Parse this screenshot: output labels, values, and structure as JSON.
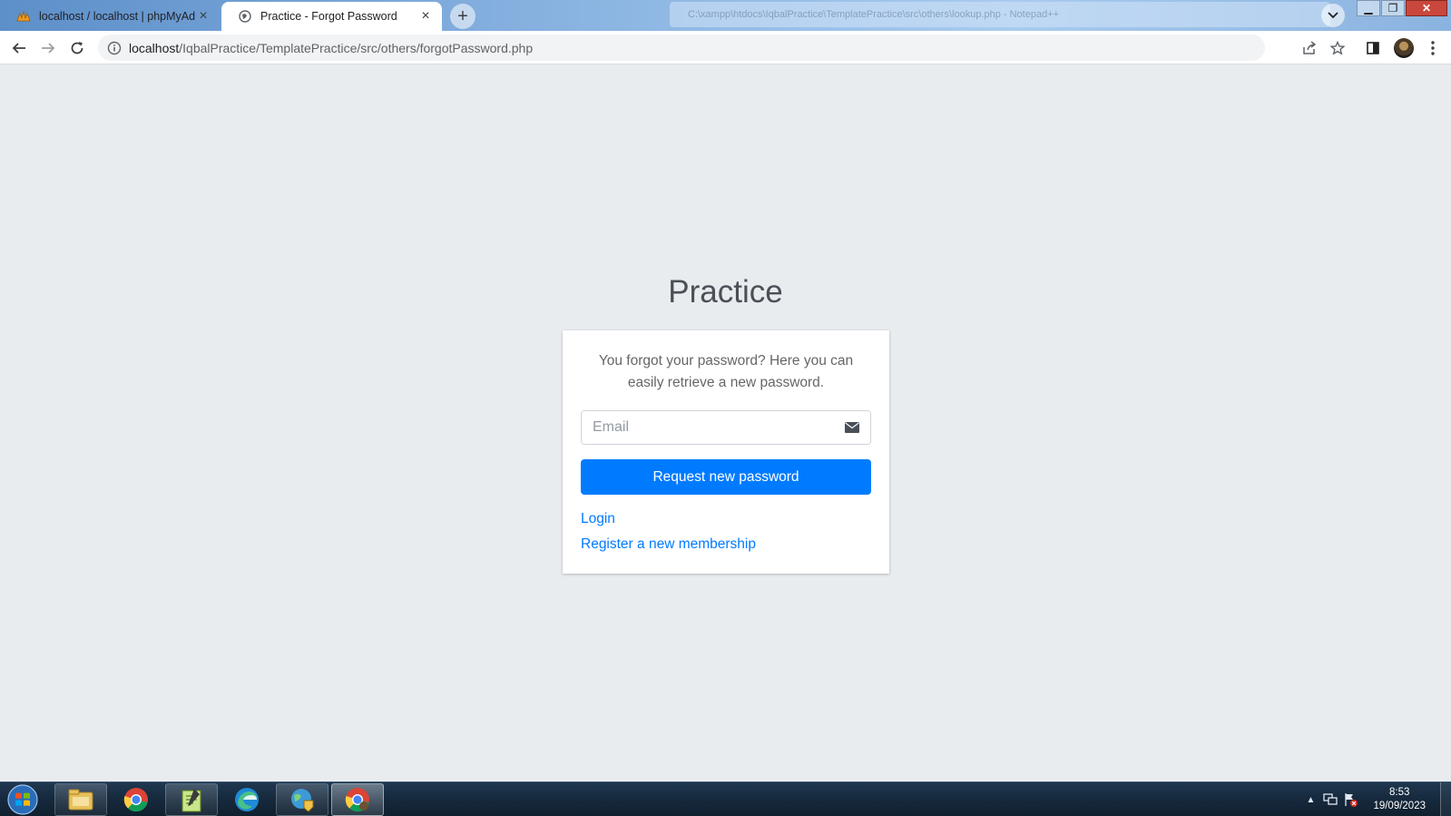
{
  "browser": {
    "tabs": [
      {
        "title": "localhost / localhost | phpMyAdmin",
        "icon": "phpmyadmin-icon",
        "active": false
      },
      {
        "title": "Practice - Forgot Password",
        "icon": "globe-icon",
        "active": true
      }
    ],
    "address_bar": {
      "host": "localhost",
      "path": "/IqbalPractice/TemplatePractice/src/others/forgotPassword.php"
    },
    "background_window_title": "C:\\xampp\\htdocs\\IqbalPractice\\TemplatePractice\\src\\others\\lookup.php - Notepad++"
  },
  "page": {
    "brand": "Practice",
    "message": "You forgot your password? Here you can easily retrieve a new password.",
    "email_placeholder": "Email",
    "email_value": "",
    "submit_label": "Request new password",
    "login_link": "Login",
    "register_link": "Register a new membership",
    "colors": {
      "background": "#e9ecef",
      "primary": "#007bff",
      "brand_text": "#495057"
    }
  },
  "taskbar": {
    "apps": [
      {
        "name": "windows-explorer",
        "icon": "folder-icon"
      },
      {
        "name": "google-chrome",
        "icon": "chrome-icon"
      },
      {
        "name": "notepad-plus-plus",
        "icon": "notepad-icon"
      },
      {
        "name": "microsoft-edge",
        "icon": "edge-icon"
      },
      {
        "name": "network-app",
        "icon": "globe-shield-icon"
      },
      {
        "name": "google-chrome-active",
        "icon": "chrome-icon"
      }
    ],
    "clock": {
      "time": "8:53",
      "date": "19/09/2023"
    }
  }
}
